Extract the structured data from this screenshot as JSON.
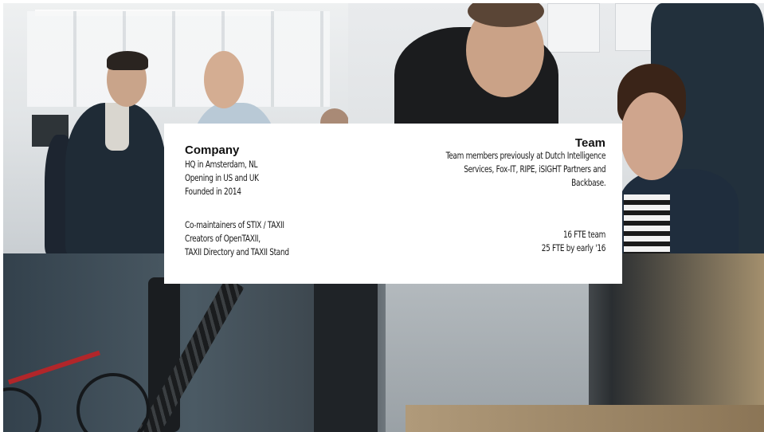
{
  "company": {
    "heading": "Company",
    "facts": [
      "HQ in Amsterdam, NL",
      "Opening in US and UK",
      "Founded in 2014"
    ],
    "standards": [
      "Co-maintainers of STIX / TAXII",
      "Creators of OpenTAXII,",
      "TAXII Directory and TAXII Stand"
    ]
  },
  "team": {
    "heading": "Team",
    "background": [
      "Team members previously at Dutch Intelligence",
      "Services, Fox-IT, RIPE, iSIGHT Partners and",
      "Backbase."
    ],
    "size": [
      "16 FTE team",
      "25 FTE by early '16"
    ]
  },
  "colors": {
    "card_background": "#ffffff",
    "text": "#1a1a1a"
  }
}
